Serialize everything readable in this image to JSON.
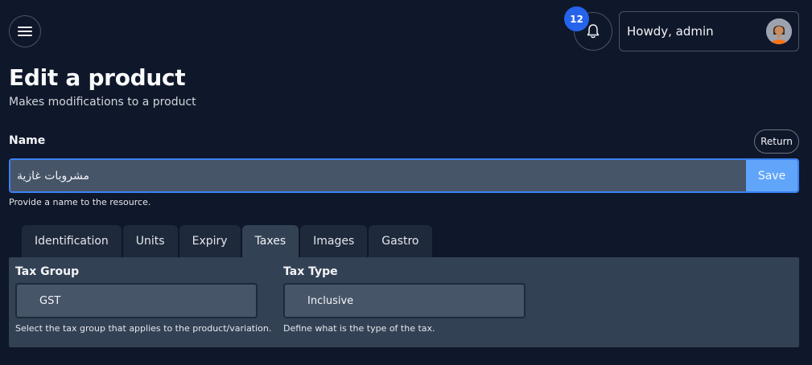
{
  "header": {
    "notifications_count": "12",
    "user_greeting": "Howdy, admin"
  },
  "page": {
    "title": "Edit a product",
    "subtitle": "Makes modifications to a product"
  },
  "name_field": {
    "label": "Name",
    "value": "مشروبات غازية",
    "help": "Provide a name to the resource.",
    "save_label": "Save",
    "return_label": "Return"
  },
  "tabs": [
    {
      "label": "Identification",
      "active": false
    },
    {
      "label": "Units",
      "active": false
    },
    {
      "label": "Expiry",
      "active": false
    },
    {
      "label": "Taxes",
      "active": true
    },
    {
      "label": "Images",
      "active": false
    },
    {
      "label": "Gastro",
      "active": false
    }
  ],
  "taxes": {
    "tax_group": {
      "label": "Tax Group",
      "value": "GST",
      "help": "Select the tax group that applies to the product/variation."
    },
    "tax_type": {
      "label": "Tax Type",
      "value": "Inclusive",
      "help": "Define what is the type of the tax."
    }
  },
  "colors": {
    "background": "#0f172a",
    "accent": "#3b82f6",
    "save_button": "#60a5fa",
    "badge": "#2563eb"
  }
}
